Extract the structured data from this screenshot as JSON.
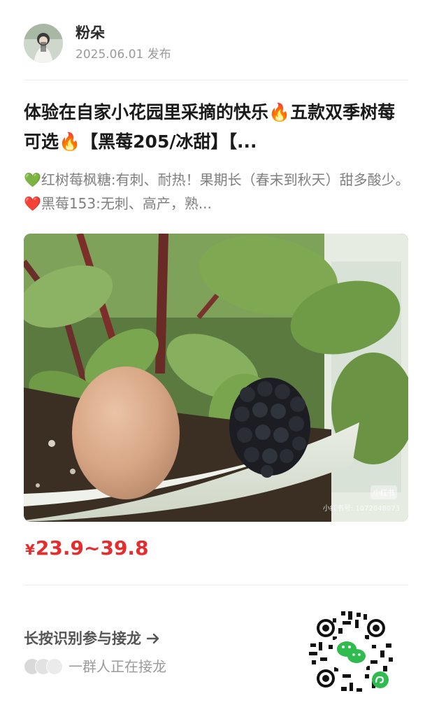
{
  "author": {
    "name": "粉朵",
    "date_label": "2025.06.01 发布"
  },
  "post": {
    "title_parts": [
      "体验在自家小花园里采摘的快乐",
      "🔥",
      "五款双季树莓可选",
      "🔥",
      "【黑莓205/冰甜】【..."
    ],
    "desc_parts": [
      "💚",
      "红树莓枫糖:有刺、耐热！果期长（春末到秋天）甜多酸少。",
      "❤️",
      "黑莓153:无刺、高产，熟..."
    ]
  },
  "image": {
    "watermark_badge": "小红书",
    "watermark_id": "小红书号: 1072048073"
  },
  "price": {
    "currency": "¥",
    "range": "23.9~39.8"
  },
  "join": {
    "cta_label": "长按识别参与接龙",
    "participants_text": "一群人正在接龙"
  },
  "colors": {
    "price": "#e52d2d",
    "title": "#1a1a1a",
    "muted": "#9a9a9a",
    "qr_green": "#2fbb4e"
  },
  "icons": [
    "fire-icon",
    "green-heart-icon",
    "red-heart-icon",
    "arrow-right-icon",
    "wechat-icon",
    "mini-program-icon"
  ]
}
